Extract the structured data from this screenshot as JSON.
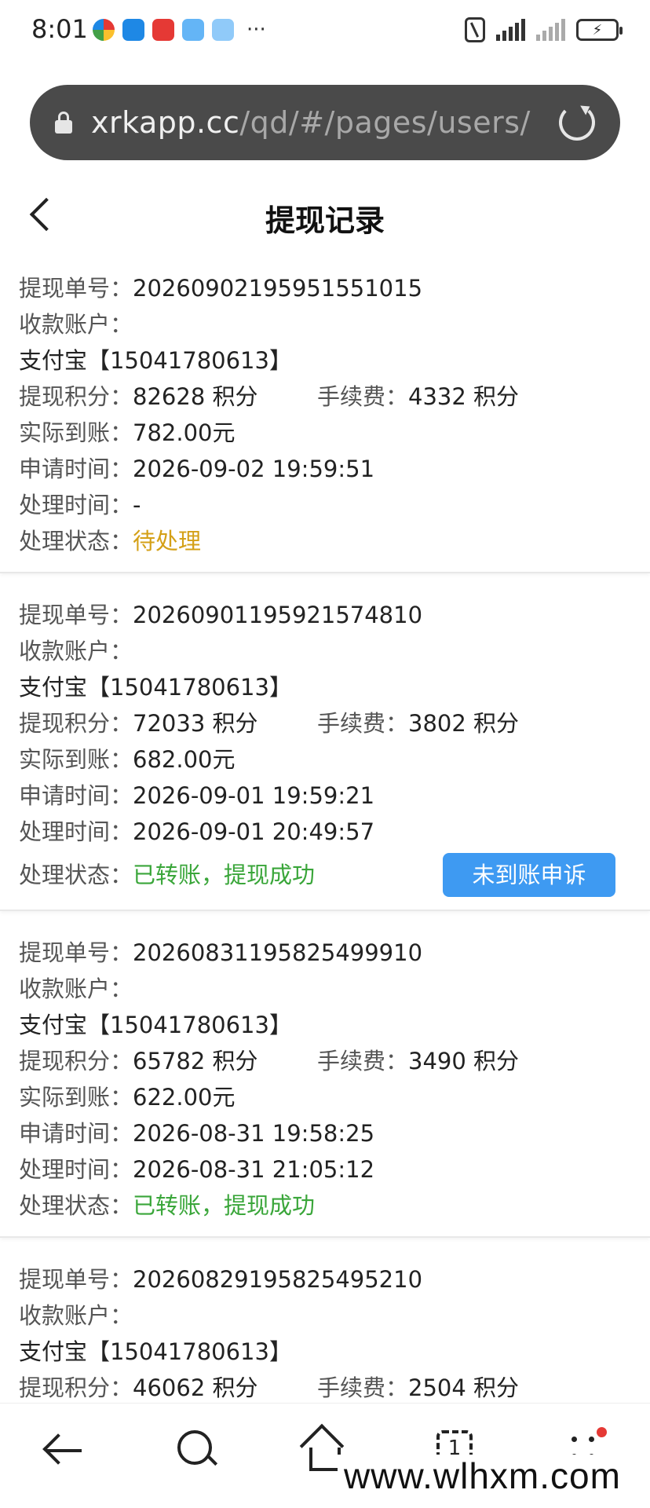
{
  "status_bar": {
    "time": "8:01",
    "more": "···",
    "battery": "⚡"
  },
  "browser": {
    "url_host": "xrkapp.cc",
    "url_path": "/qd/#/pages/users/wit"
  },
  "header": {
    "title": "提现记录"
  },
  "labels": {
    "order_no": "提现单号：",
    "account": "收款账户：",
    "points": "提现积分：",
    "fee": "手续费：",
    "received": "实际到账：",
    "apply_time": "申请时间：",
    "process_time": "处理时间：",
    "status": "处理状态："
  },
  "records": [
    {
      "order_no": "20260902195951551015",
      "account_value": "支付宝【15041780613】",
      "points": "82628 积分",
      "fee": "4332 积分",
      "received": "782.00元",
      "apply_time": "2026-09-02 19:59:51",
      "process_time": "-",
      "status": "待处理"
    },
    {
      "order_no": "20260901195921574810",
      "account_value": "支付宝【15041780613】",
      "points": "72033 积分",
      "fee": "3802 积分",
      "received": "682.00元",
      "apply_time": "2026-09-01 19:59:21",
      "process_time": "2026-09-01 20:49:57",
      "status": "已转账，提现成功",
      "appeal_button": "未到账申诉"
    },
    {
      "order_no": "20260831195825499910",
      "account_value": "支付宝【15041780613】",
      "points": "65782 积分",
      "fee": "3490 积分",
      "received": "622.00元",
      "apply_time": "2026-08-31 19:58:25",
      "process_time": "2026-08-31 21:05:12",
      "status": "已转账，提现成功"
    },
    {
      "order_no": "20260829195825495210",
      "account_value": "支付宝【15041780613】",
      "points": "46062 积分",
      "fee": "2504 积分"
    }
  ],
  "bottom_nav": {
    "tabs_count": "1"
  },
  "watermark": "www.wlhxm.com",
  "colors": {
    "pending": "#d4a017",
    "success": "#3aa63a",
    "button": "#3e9af2"
  },
  "icons": [
    "lock-icon",
    "reload-icon",
    "back-icon",
    "nav-back-icon",
    "search-icon",
    "home-icon",
    "tabs-icon",
    "menu-icon"
  ]
}
